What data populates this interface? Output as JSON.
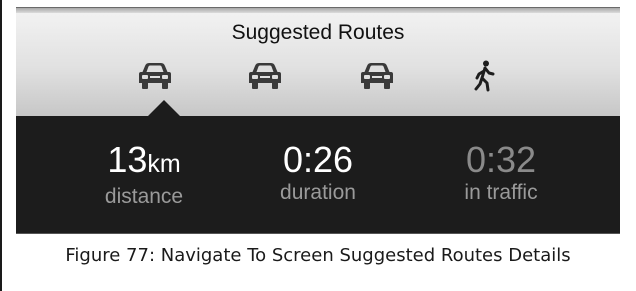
{
  "header": {
    "title": "Suggested Routes",
    "route_modes": [
      {
        "icon": "car-icon",
        "selected": true
      },
      {
        "icon": "car-icon",
        "selected": false
      },
      {
        "icon": "car-icon",
        "selected": false
      },
      {
        "icon": "walking-person-icon",
        "selected": false
      }
    ]
  },
  "details": {
    "distance": {
      "value": "13",
      "unit": "km",
      "label": "distance"
    },
    "duration": {
      "value": "0:26",
      "label": "duration"
    },
    "traffic": {
      "value": "0:32",
      "label": "in traffic"
    }
  },
  "caption": "Figure 77: Navigate To Screen Suggested Routes Details",
  "colors": {
    "header_top": "#f3f3f3",
    "header_bottom": "#c7c7c7",
    "panel": "#1c1c1c",
    "label": "#9a9a9a",
    "value": "#ffffff",
    "value_dim": "#8a8a8a"
  }
}
